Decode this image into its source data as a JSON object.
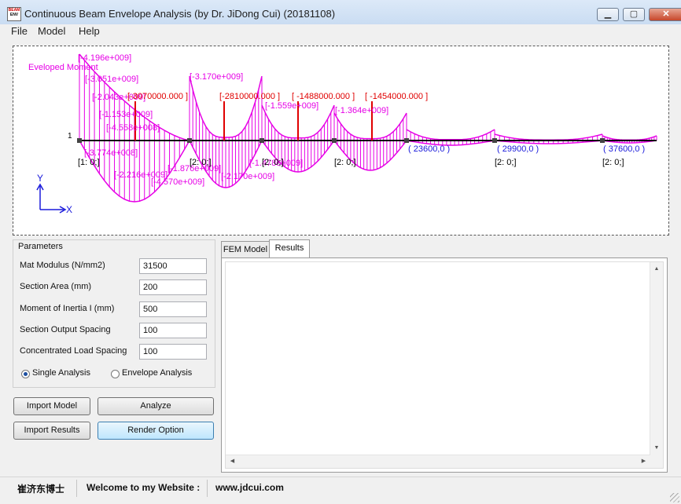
{
  "window": {
    "title": "Continuous Beam Envelope Analysis (by Dr. JiDong Cui) (20181108)",
    "icon_text_top": "BEAM",
    "icon_text_bottom": "ENV",
    "minimize_glyph": "▁",
    "maximize_glyph": "▢",
    "close_glyph": "✕"
  },
  "menu": {
    "items": [
      "File",
      "Model",
      "Help"
    ]
  },
  "diagram": {
    "title": "Eveloped Moment",
    "axis_x": "X",
    "axis_y": "Y",
    "node_one_label": "1",
    "line_color": "#e600e6",
    "load_color": "#e00000",
    "coord_color": "#1a1adb",
    "top_values": [
      "[-4.196e+009]",
      "[-3.051e+009]",
      "[-2.043e+009]",
      "[-1.153e+009]",
      "[-4.558e+008]",
      "[-3.170e+009]",
      "[-1.559e+009]",
      "[-1.364e+009]"
    ],
    "load_labels": [
      "[-3070000.000 ]",
      "[-2810000.000 ]",
      "[ -1488000.000 ]",
      "[ -1454000.000 ]"
    ],
    "bottom_values": [
      "[-3.774e+008]",
      "[-2.216e+009]",
      "[-1.876e+009]",
      "[-4.570e+009]",
      "[-2.170e+009]",
      "[-1.478e+009]"
    ],
    "supports": [
      "[1: 0;]",
      "[2: 0;]",
      "[2: 0;]",
      "[2: 0;]",
      "[2: 0;]",
      "[2: 0;]"
    ],
    "coords": [
      "( 23600,0 )",
      "( 29900,0 )",
      "( 37600,0 )"
    ]
  },
  "parameters": {
    "group_title": "Parameters",
    "fields": [
      {
        "label": "Mat Modulus (N/mm2)",
        "value": "31500"
      },
      {
        "label": "Section Area  (mm)",
        "value": "200"
      },
      {
        "label": "Moment of Inertia I (mm)",
        "value": "500"
      },
      {
        "label": "Section Output Spacing",
        "value": "100"
      },
      {
        "label": "Concentrated Load Spacing",
        "value": "100"
      }
    ],
    "radio_single": "Single Analysis",
    "radio_envelope": "Envelope Analysis"
  },
  "buttons": {
    "import_model": "Import Model",
    "analyze": "Analyze",
    "import_results": "Import Results",
    "render_option": "Render Option"
  },
  "tabs": {
    "fem_model": "FEM Model",
    "results": "Results"
  },
  "scroll": {
    "up": "▲",
    "down": "▼",
    "left": "◀",
    "right": "▶"
  },
  "status": {
    "name": "崔济东博士",
    "welcome": "Welcome to my Website :",
    "website": "www.jdcui.com"
  }
}
